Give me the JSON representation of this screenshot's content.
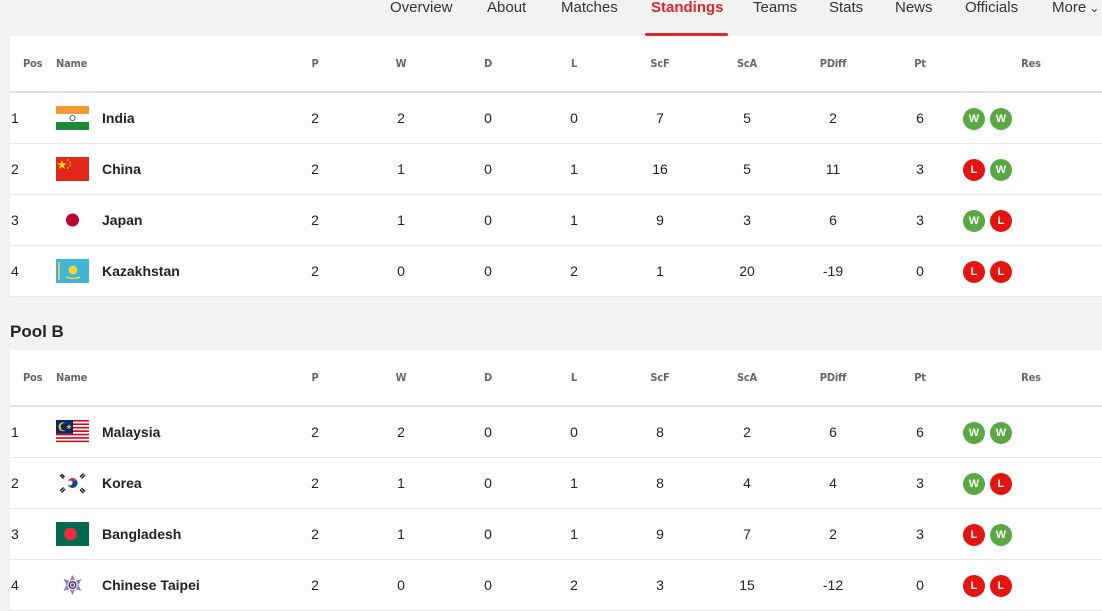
{
  "nav": {
    "items": [
      "Overview",
      "About",
      "Matches",
      "Standings",
      "Teams",
      "Stats",
      "News",
      "Officials",
      "More"
    ],
    "active": "Standings"
  },
  "headers": [
    "Pos",
    "Name",
    "P",
    "W",
    "D",
    "L",
    "ScF",
    "ScA",
    "PDiff",
    "Pt",
    "Res"
  ],
  "pools": [
    {
      "title": "",
      "rows": [
        {
          "pos": "1",
          "name": "India",
          "flag": "india-flag-icon",
          "p": "2",
          "w": "2",
          "d": "0",
          "l": "0",
          "scf": "7",
          "sca": "5",
          "pdiff": "2",
          "pt": "6",
          "res": [
            "W",
            "W"
          ]
        },
        {
          "pos": "2",
          "name": "China",
          "flag": "china-flag-icon",
          "p": "2",
          "w": "1",
          "d": "0",
          "l": "1",
          "scf": "16",
          "sca": "5",
          "pdiff": "11",
          "pt": "3",
          "res": [
            "L",
            "W"
          ]
        },
        {
          "pos": "3",
          "name": "Japan",
          "flag": "japan-flag-icon",
          "p": "2",
          "w": "1",
          "d": "0",
          "l": "1",
          "scf": "9",
          "sca": "3",
          "pdiff": "6",
          "pt": "3",
          "res": [
            "W",
            "L"
          ]
        },
        {
          "pos": "4",
          "name": "Kazakhstan",
          "flag": "kazakhstan-flag-icon",
          "p": "2",
          "w": "0",
          "d": "0",
          "l": "2",
          "scf": "1",
          "sca": "20",
          "pdiff": "-19",
          "pt": "0",
          "res": [
            "L",
            "L"
          ]
        }
      ]
    },
    {
      "title": "Pool B",
      "rows": [
        {
          "pos": "1",
          "name": "Malaysia",
          "flag": "malaysia-flag-icon",
          "p": "2",
          "w": "2",
          "d": "0",
          "l": "0",
          "scf": "8",
          "sca": "2",
          "pdiff": "6",
          "pt": "6",
          "res": [
            "W",
            "W"
          ]
        },
        {
          "pos": "2",
          "name": "Korea",
          "flag": "korea-flag-icon",
          "p": "2",
          "w": "1",
          "d": "0",
          "l": "1",
          "scf": "8",
          "sca": "4",
          "pdiff": "4",
          "pt": "3",
          "res": [
            "W",
            "L"
          ]
        },
        {
          "pos": "3",
          "name": "Bangladesh",
          "flag": "bangladesh-flag-icon",
          "p": "2",
          "w": "1",
          "d": "0",
          "l": "1",
          "scf": "9",
          "sca": "7",
          "pdiff": "2",
          "pt": "3",
          "res": [
            "L",
            "W"
          ]
        },
        {
          "pos": "4",
          "name": "Chinese Taipei",
          "flag": "chinese-taipei-flag-icon",
          "p": "2",
          "w": "0",
          "d": "0",
          "l": "2",
          "scf": "3",
          "sca": "15",
          "pdiff": "-12",
          "pt": "0",
          "res": [
            "L",
            "L"
          ]
        }
      ]
    }
  ],
  "colors": {
    "accent": "#e0252b",
    "win": "#5aa843",
    "loss": "#e5140f"
  }
}
